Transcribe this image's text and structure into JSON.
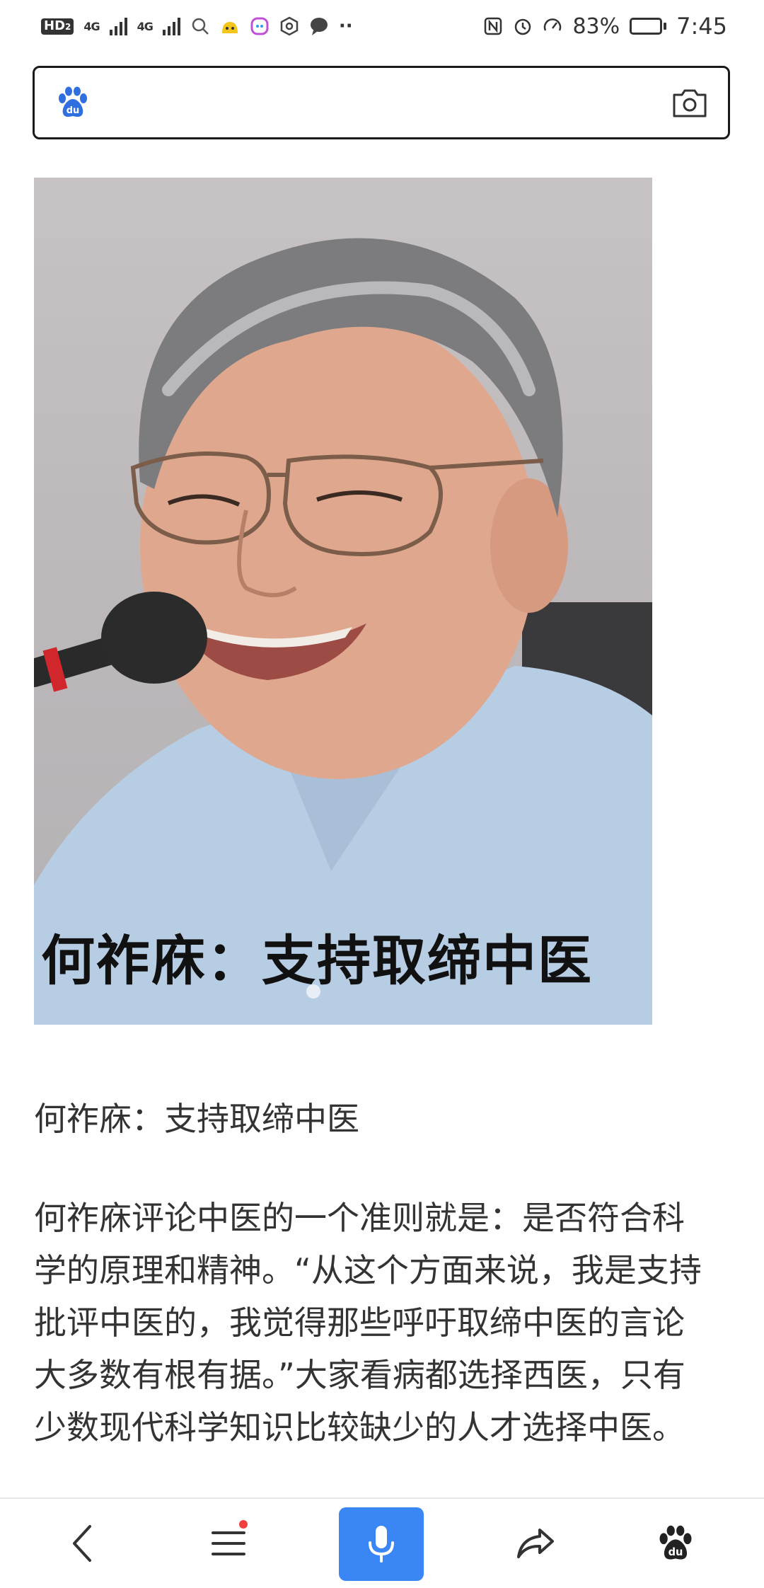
{
  "status_bar": {
    "hd_label": "HD",
    "sim_index": "2",
    "signal1_label": "4G",
    "signal2_label": "4G",
    "more_dots": "··",
    "battery_percent": "83%",
    "battery_level": 0.83,
    "time": "7:45"
  },
  "search": {
    "placeholder": ""
  },
  "photo": {
    "overlay_text": "何祚庥：支持取缔中医"
  },
  "article": {
    "caption": "何祚庥：支持取缔中医",
    "lines": [
      "何祚庥评论中医的一个准则就是：是否符合科",
      "学的原理和精神。“从这个方面来说，我是支持",
      "批评中医的，我觉得那些呼吁取缔中医的言论",
      "大多数有根有据。”大家看病都选择西医，只有",
      "少数现代科学知识比较缺少的人才选择中医。"
    ]
  },
  "bottom_nav": {
    "icons": [
      "back-icon",
      "menu-icon",
      "microphone-icon",
      "share-icon",
      "baidu-paw-icon"
    ],
    "accent_color": "#3a86f5",
    "notification_dot_color": "#f04040"
  }
}
